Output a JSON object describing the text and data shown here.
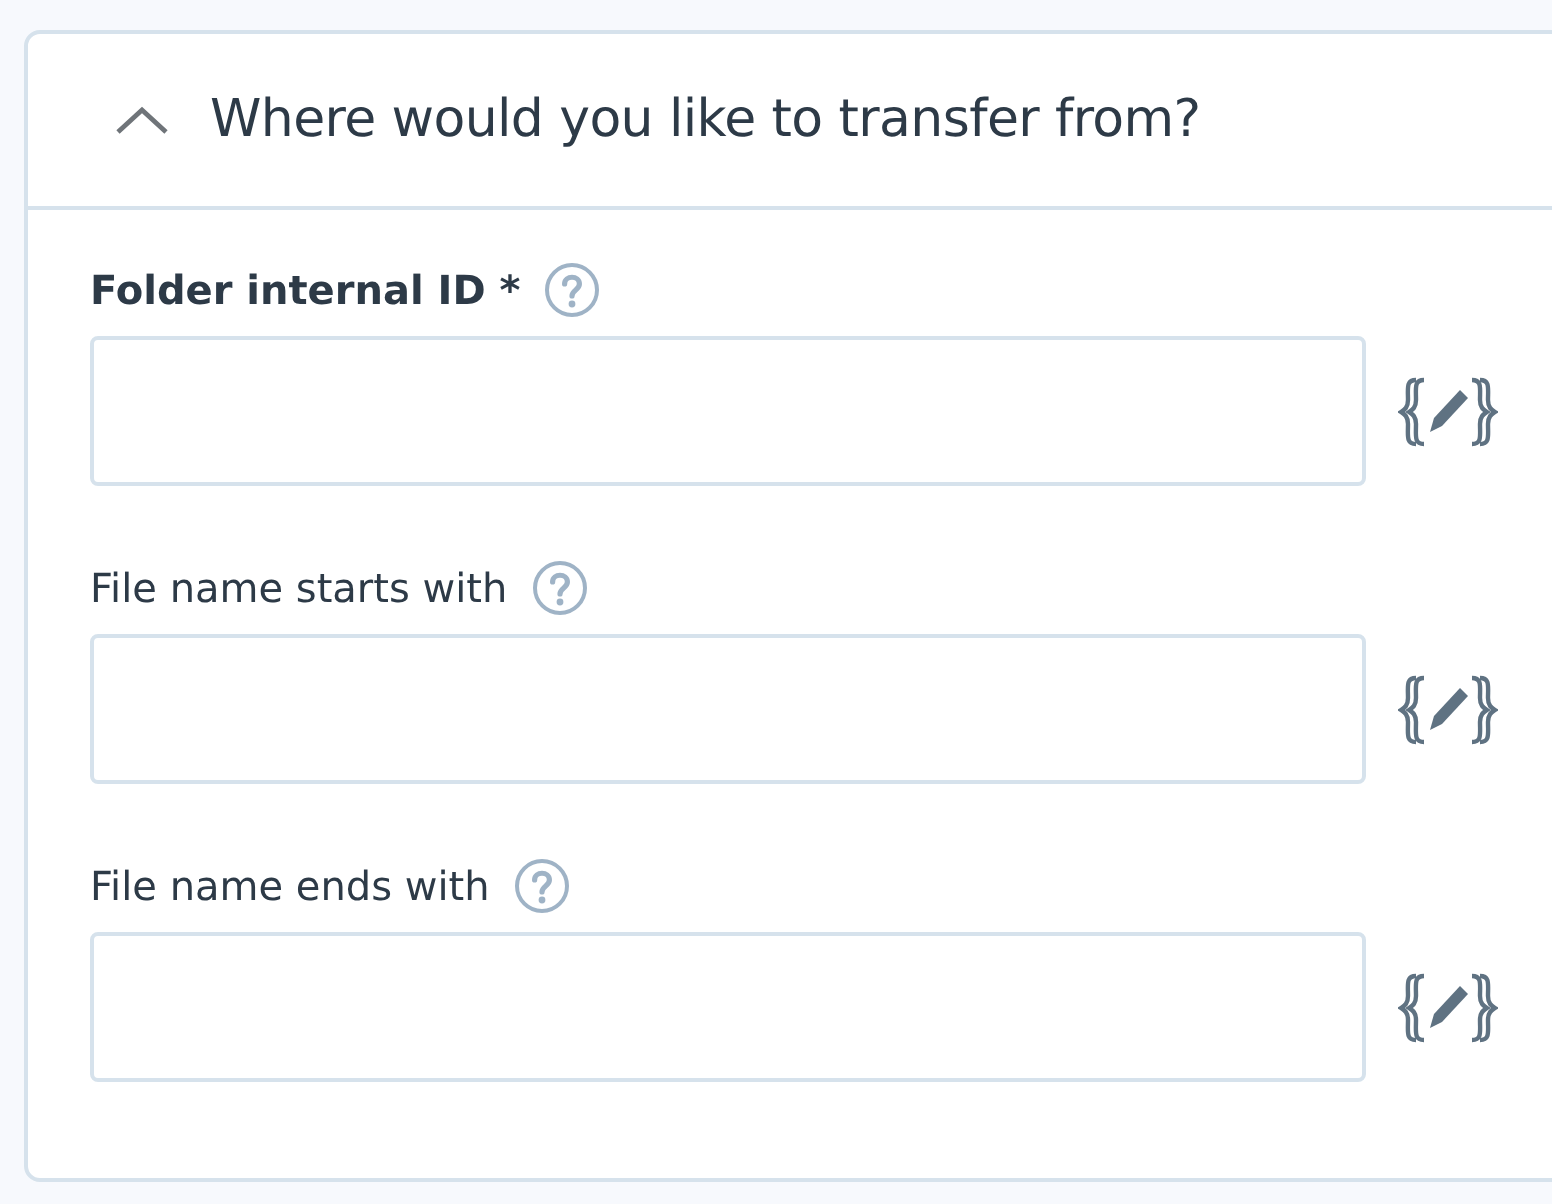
{
  "section": {
    "title": "Where would you like to transfer from?",
    "expanded": true
  },
  "fields": [
    {
      "label": "Folder internal ID *",
      "required": true
    },
    {
      "label": "File name starts with",
      "required": false
    },
    {
      "label": "File name ends with",
      "required": false
    }
  ]
}
